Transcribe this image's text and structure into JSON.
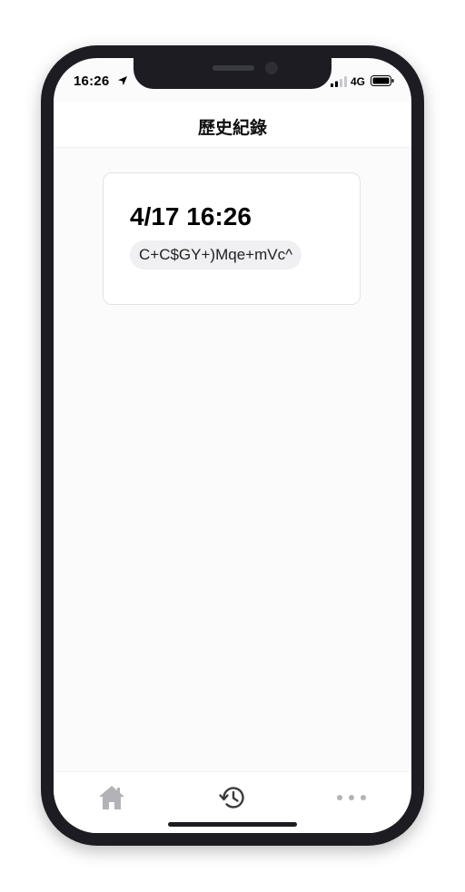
{
  "status_bar": {
    "time": "16:26",
    "network": "4G"
  },
  "header": {
    "title": "歷史紀錄"
  },
  "history": {
    "items": [
      {
        "datetime": "4/17 16:26",
        "code": "C+C$GY+)Mqe+mVc^"
      }
    ]
  },
  "tabbar": {
    "tabs": [
      {
        "icon": "home-icon",
        "active": false
      },
      {
        "icon": "history-icon",
        "active": true
      },
      {
        "icon": "more-icon",
        "active": false
      }
    ]
  },
  "colors": {
    "active_tab": "#3a3a3a",
    "inactive_tab": "#b3b3b7",
    "pill_background": "#f0f0f2",
    "frame": "#1c1c22"
  }
}
